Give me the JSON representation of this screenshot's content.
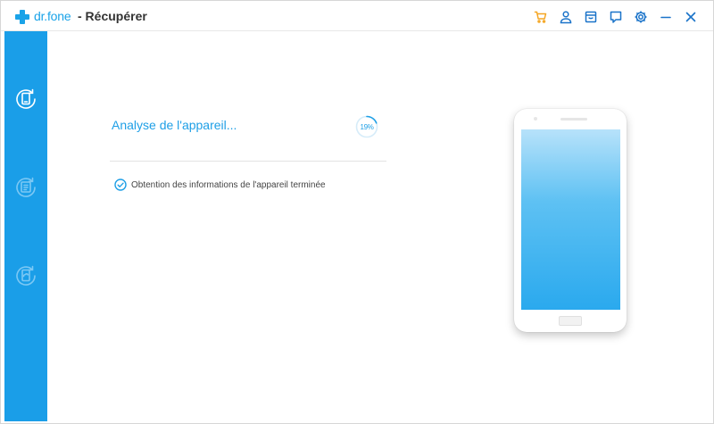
{
  "app": {
    "brand": "dr.fone",
    "title": "- Récupérer"
  },
  "toolbar": {
    "icons": [
      "cart-icon",
      "user-icon",
      "store-icon",
      "feedback-icon",
      "settings-icon",
      "minimize-icon",
      "close-icon"
    ]
  },
  "sidebar": {
    "items": [
      {
        "name": "recover-from-device",
        "active": true
      },
      {
        "name": "recover-from-itunes",
        "active": false
      },
      {
        "name": "recover-from-icloud",
        "active": false
      }
    ]
  },
  "scan": {
    "status": "Analyse de l'appareil...",
    "progress": 19,
    "progress_label": "19%",
    "steps": [
      "Obtention des informations de l'appareil terminée"
    ]
  },
  "colors": {
    "accent": "#1a9ee8",
    "cart": "#f5a623",
    "text_dark": "#333333"
  }
}
